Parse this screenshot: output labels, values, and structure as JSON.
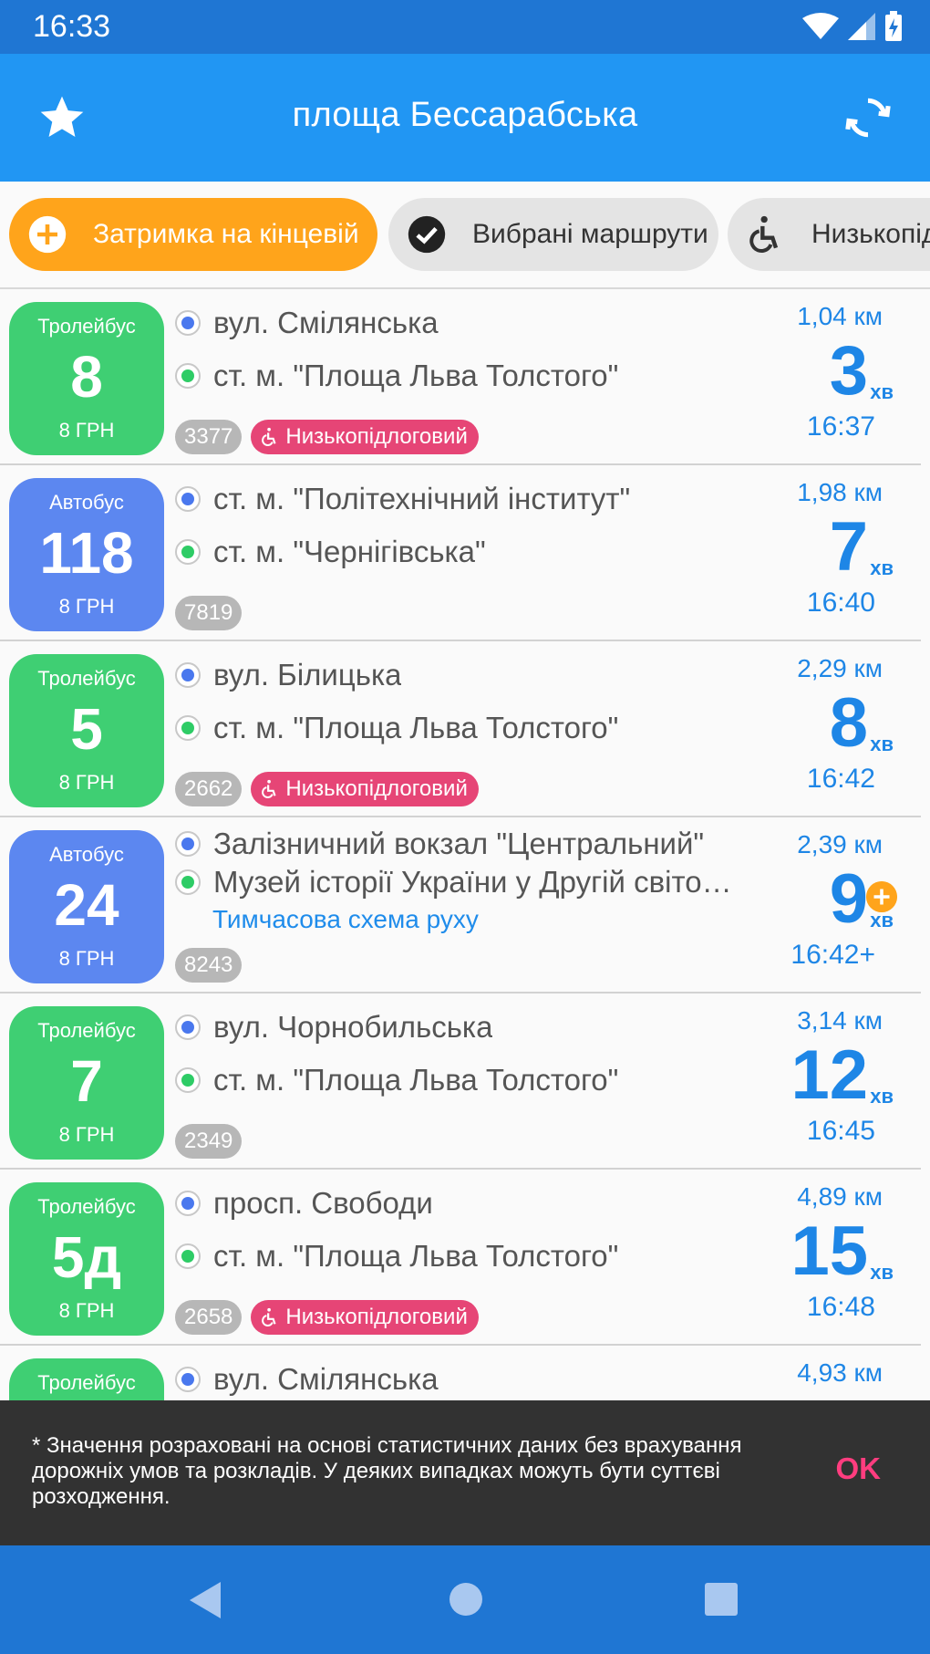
{
  "status_bar": {
    "time": "16:33"
  },
  "app_bar": {
    "title": "площа Бессарабська",
    "favorite_icon": "star-icon",
    "refresh_icon": "refresh-icon"
  },
  "filters": [
    {
      "label": "Затримка на кінцевій",
      "icon": "add-circle-icon"
    },
    {
      "label": "Вибрані маршрути",
      "icon": "check-circle-icon"
    },
    {
      "label": "Низькопідлогові",
      "icon": "wheelchair-icon"
    }
  ],
  "routes": [
    {
      "type": "Тролейбус",
      "number": "8",
      "price": "8 ГРН",
      "from": "вул. Смілянська",
      "to": "ст. м. \"Площа Льва Толстого\"",
      "vehicle": "3377",
      "lowfloor": "Низькопідлоговий",
      "distance": "1,04 км",
      "minutes": "3",
      "unit": "хв",
      "arrival": "16:37"
    },
    {
      "type": "Автобус",
      "number": "118",
      "price": "8 ГРН",
      "from": "ст. м. \"Політехнічний інститут\"",
      "to": "ст. м. \"Чернігівська\"",
      "vehicle": "7819",
      "distance": "1,98 км",
      "minutes": "7",
      "unit": "хв",
      "arrival": "16:40"
    },
    {
      "type": "Тролейбус",
      "number": "5",
      "price": "8 ГРН",
      "from": "вул. Білицька",
      "to": "ст. м. \"Площа Льва Толстого\"",
      "vehicle": "2662",
      "lowfloor": "Низькопідлоговий",
      "distance": "2,29 км",
      "minutes": "8",
      "unit": "хв",
      "arrival": "16:42"
    },
    {
      "type": "Автобус",
      "number": "24",
      "price": "8 ГРН",
      "from": "Залізничний вокзал \"Центральний\"",
      "to": "Музей історії України у Другій світо…",
      "note": "Тимчасова схема руху",
      "vehicle": "8243",
      "distance": "2,39 км",
      "minutes": "9",
      "unit": "хв",
      "arrival": "16:42+"
    },
    {
      "type": "Тролейбус",
      "number": "7",
      "price": "8 ГРН",
      "from": "вул. Чорнобильська",
      "to": "ст. м. \"Площа Льва Толстого\"",
      "vehicle": "2349",
      "distance": "3,14 км",
      "minutes": "12",
      "unit": "хв",
      "arrival": "16:45"
    },
    {
      "type": "Тролейбус",
      "number": "5д",
      "price": "8 ГРН",
      "from": "просп. Свободи",
      "to": "ст. м. \"Площа Льва Толстого\"",
      "vehicle": "2658",
      "lowfloor": "Низькопідлоговий",
      "distance": "4,89 км",
      "minutes": "15",
      "unit": "хв",
      "arrival": "16:48"
    },
    {
      "type": "Тролейбус",
      "from": "вул. Смілянська",
      "distance": "4,93 км"
    }
  ],
  "snackbar": {
    "message": "* Значення розраховані на основі статистичних даних без врахування дорожніх умов та розкладів. У деяких випадках можуть бути суттєві розходження.",
    "action": "OK"
  },
  "colors": {
    "primary": "#2196f3",
    "trolleybus": "#3fcf73",
    "bus": "#5c87f0",
    "lowfloor": "#e64576",
    "accent": "#ffa41b",
    "time": "#1e86e6"
  }
}
